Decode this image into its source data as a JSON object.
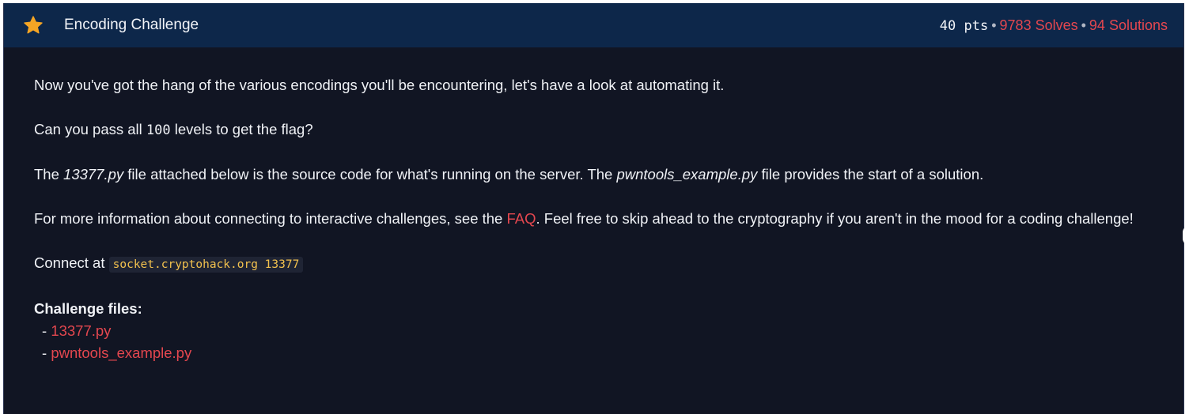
{
  "header": {
    "star_icon": "star-icon",
    "star_color": "#f5a524",
    "title": "Encoding Challenge",
    "points": "40 pts",
    "separator": "•",
    "solves": "9783 Solves",
    "solutions": "94 Solutions"
  },
  "description": {
    "p1": "Now you've got the hang of the various encodings you'll be encountering, let's have a look at automating it.",
    "p2_before": "Can you pass all ",
    "p2_number": "100",
    "p2_after": " levels to get the flag?",
    "p3_the": "The ",
    "p3_file1": "13377.py",
    "p3_middle": " file attached below is the source code for what's running on the server. The ",
    "p3_file2": "pwntools_example.py",
    "p3_end": " file provides the start of a solution.",
    "p4_before": "For more information about connecting to interactive challenges, see the ",
    "p4_link": "FAQ",
    "p4_after": ". Feel free to skip ahead to the cryptography if you aren't in the mood for a coding challenge!",
    "connect_label": "Connect at ",
    "connect_address": "socket.cryptohack.org 13377"
  },
  "files": {
    "heading": "Challenge files:",
    "bullet": "- ",
    "items": [
      "13377.py",
      "pwntools_example.py"
    ]
  },
  "colors": {
    "accent_red": "#e4474f",
    "header_bg": "#0d274a",
    "panel_bg": "#111523",
    "code_text": "#f2c14e"
  }
}
